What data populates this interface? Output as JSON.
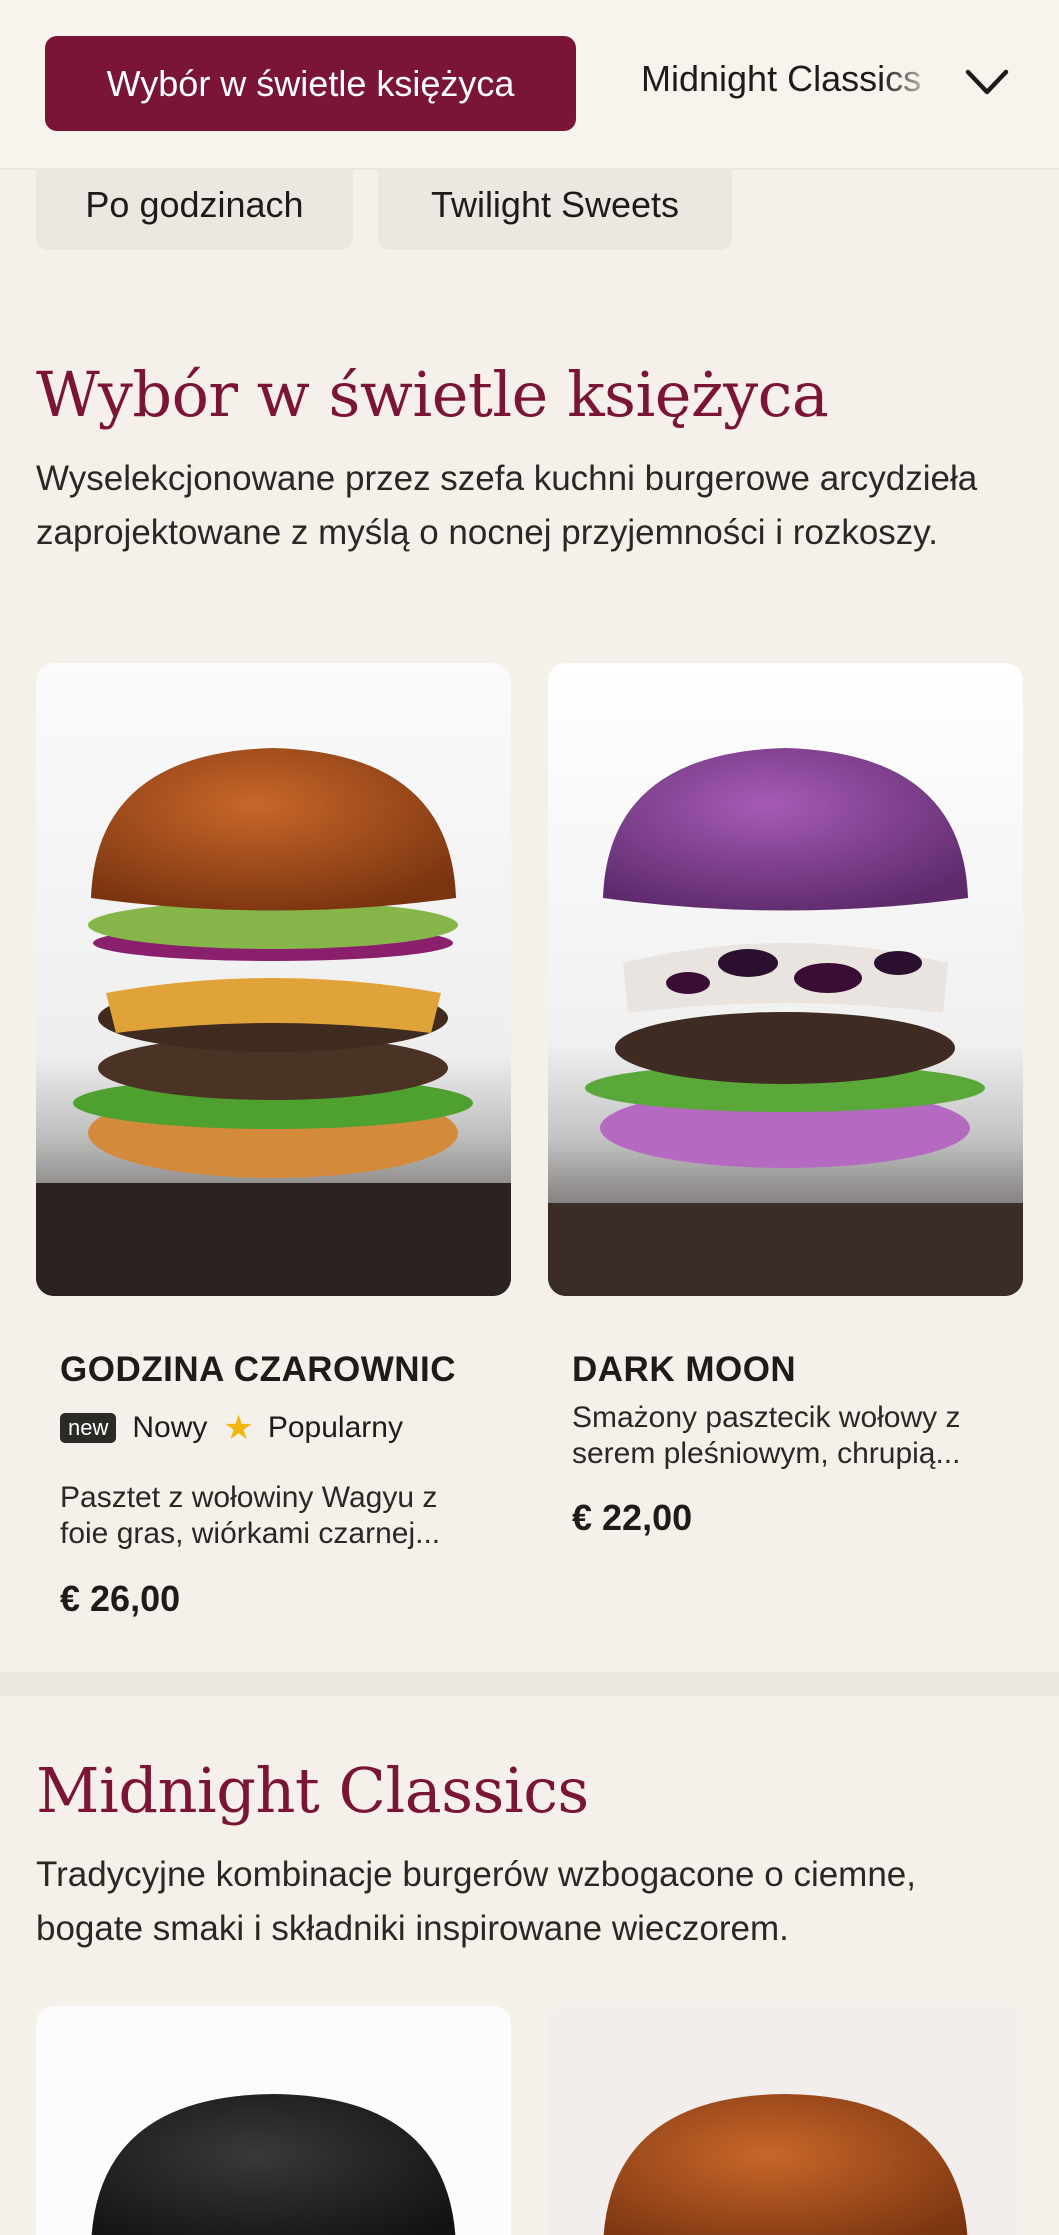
{
  "nav": {
    "active_category": "Wybór w świetle księżyca",
    "next_category": "Midnight Classics",
    "chips": [
      "Po godzinach",
      "Twilight Sweets"
    ]
  },
  "sections": [
    {
      "title": "Wybór w świetle księżyca",
      "description": "Wyselekcjonowane przez szefa kuchni burgerowe arcydzieła zaprojektowane z myślą o nocnej przyjemności i rozkoszy.",
      "items": [
        {
          "name": "GODZINA CZAROWNIC",
          "badge_new": "new",
          "badge_new_label": "Nowy",
          "badge_popular_label": "Popularny",
          "description": "Pasztet z wołowiny Wagyu z foie gras, wiórkami czarnej...",
          "price": "€ 26,00"
        },
        {
          "name": "DARK MOON",
          "description": "Smażony pasztecik wołowy z serem pleśniowym, chrupią...",
          "price": "€ 22,00"
        }
      ]
    },
    {
      "title": "Midnight Classics",
      "description": "Tradycyjne kombinacje burgerów wzbogacone o ciemne, bogate smaki i składniki inspirowane wieczorem."
    }
  ],
  "icons": {
    "dropdown": "chevron-down-icon",
    "popular": "star-icon"
  },
  "colors": {
    "accent": "#7b1536",
    "background": "#f5f1ea",
    "star": "#f2b70f"
  }
}
